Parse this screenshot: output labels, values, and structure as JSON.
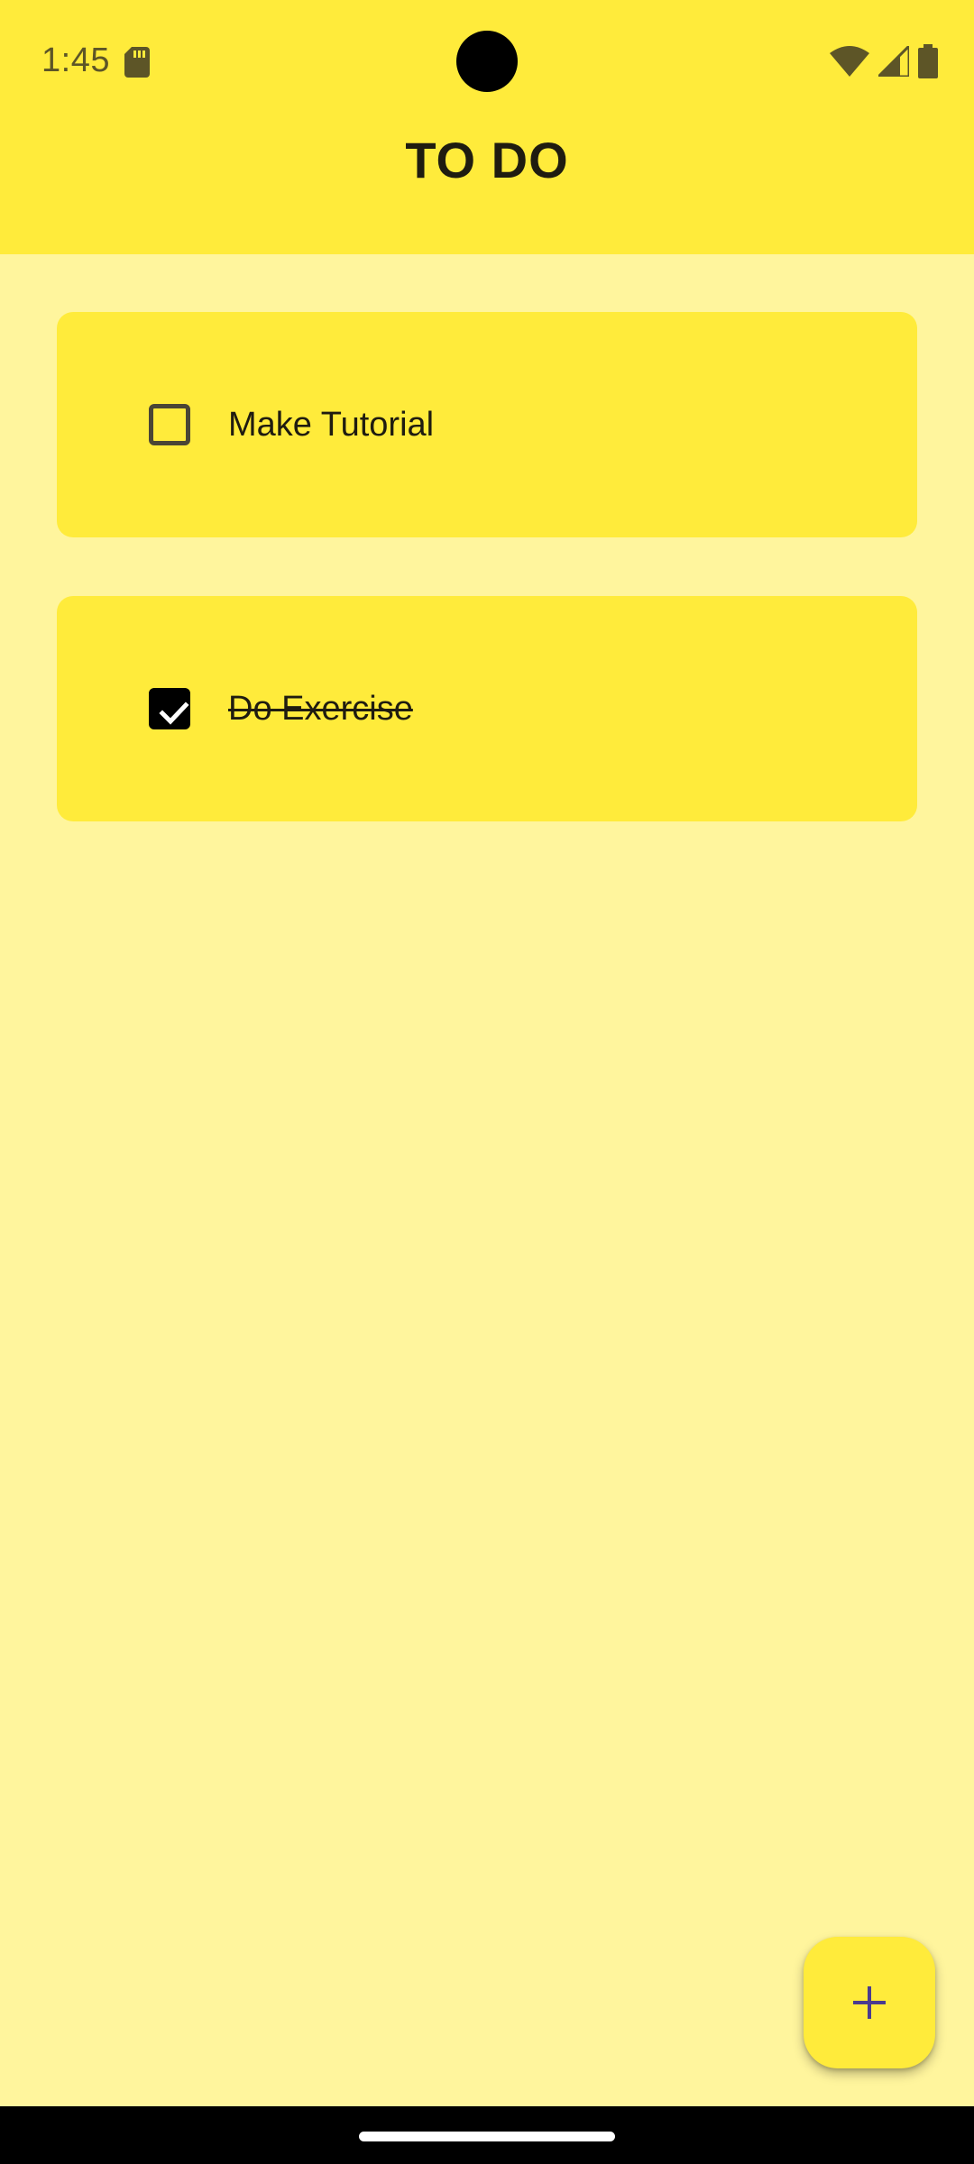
{
  "status_bar": {
    "time": "1:45",
    "icons": [
      "sd-card-icon",
      "wifi-icon",
      "cell-signal-icon",
      "battery-icon"
    ]
  },
  "app_bar": {
    "title": "TO DO",
    "background": "#ffeb3b"
  },
  "todos": [
    {
      "label": "Make Tutorial",
      "checked": false
    },
    {
      "label": "Do Exercise",
      "checked": true
    }
  ],
  "fab": {
    "icon": "plus-icon",
    "icon_color": "#4a3b8f"
  },
  "colors": {
    "page_background": "#fff59d",
    "card_background": "#ffeb3b",
    "text": "#1f1c10"
  }
}
